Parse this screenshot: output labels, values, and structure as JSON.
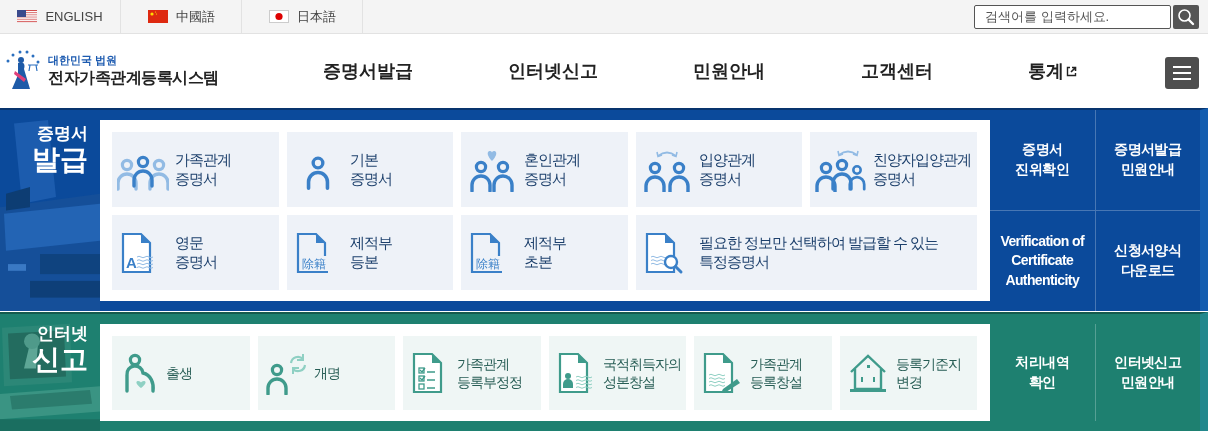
{
  "languages": [
    {
      "kind": "us",
      "label": "ENGLISH"
    },
    {
      "kind": "cn",
      "label": "中國語"
    },
    {
      "kind": "jp",
      "label": "日本語"
    }
  ],
  "search": {
    "placeholder": "검색어를 입력하세요."
  },
  "logo": {
    "org": "대한민국 법원",
    "title": "전자가족관계등록시스템"
  },
  "nav": [
    {
      "label": "증명서발급",
      "external": false
    },
    {
      "label": "인터넷신고",
      "external": false
    },
    {
      "label": "민원안내",
      "external": false
    },
    {
      "label": "고객센터",
      "external": false
    },
    {
      "label": "통계",
      "external": true
    }
  ],
  "sections": [
    {
      "color": "#0b4a9b",
      "title": [
        "증명서",
        "발급"
      ],
      "rows": [
        [
          {
            "kind": "family",
            "lines": [
              "가족관계",
              "증명서"
            ]
          },
          {
            "kind": "person",
            "lines": [
              "기본",
              "증명서"
            ]
          },
          {
            "kind": "marriage",
            "lines": [
              "혼인관계",
              "증명서"
            ]
          },
          {
            "kind": "adoption",
            "lines": [
              "입양관계",
              "증명서"
            ]
          },
          {
            "kind": "parentadoption",
            "lines": [
              "친양자입양관계",
              "증명서"
            ]
          }
        ],
        [
          {
            "kind": "english",
            "icon_text": "A",
            "lines": [
              "영문",
              "증명서"
            ]
          },
          {
            "kind": "removal",
            "icon_text": "除籍",
            "lines": [
              "제적부",
              "등본"
            ]
          },
          {
            "kind": "removal",
            "icon_text": "除籍",
            "lines": [
              "제적부",
              "초본"
            ]
          },
          {
            "kind": "search",
            "lines": [
              "필요한 정보만 선택하여 발급할 수 있는",
              "특정증명서"
            ]
          }
        ]
      ],
      "links": [
        [
          {
            "lines": [
              "증명서",
              "진위확인"
            ]
          },
          {
            "lines": [
              "증명서발급",
              "민원안내"
            ]
          }
        ],
        [
          {
            "lines": [
              "Verification of",
              "Certificate",
              "Authenticity"
            ]
          },
          {
            "lines": [
              "신청서양식",
              "다운로드"
            ]
          }
        ]
      ]
    },
    {
      "color": "#1e8070",
      "title": [
        "인터넷",
        "신고"
      ],
      "rows": [
        [
          {
            "kind": "birth",
            "lines": [
              "출생"
            ]
          },
          {
            "kind": "rename",
            "lines": [
              "개명"
            ]
          },
          {
            "kind": "checklist",
            "lines": [
              "가족관계",
              "등록부정정"
            ]
          },
          {
            "kind": "nationality",
            "lines": [
              "국적취득자의",
              "성본창설"
            ]
          },
          {
            "kind": "writing",
            "lines": [
              "가족관계",
              "등록창설"
            ]
          },
          {
            "kind": "house",
            "lines": [
              "등록기준지",
              "변경"
            ]
          }
        ]
      ],
      "links": [
        [
          {
            "lines": [
              "처리내역",
              "확인"
            ]
          },
          {
            "lines": [
              "인터넷신고",
              "민원안내"
            ]
          }
        ]
      ]
    }
  ]
}
